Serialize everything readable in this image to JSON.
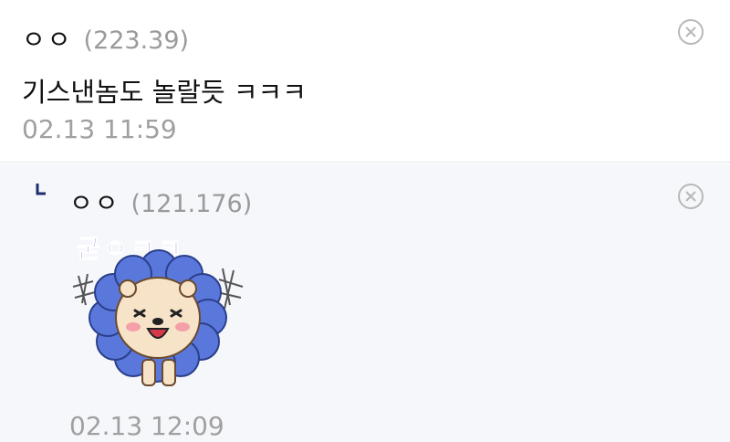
{
  "main_comment": {
    "author": "ㅇㅇ",
    "ip": "(223.39)",
    "text": "기스낸놈도 놀랄듯 ㅋㅋㅋ",
    "timestamp": "02.13 11:59",
    "delete_icon": "circle-x-icon"
  },
  "reply_comment": {
    "reply_icon": "reply-arrow-icon",
    "author": "ㅇㅇ",
    "ip": "(121.176)",
    "sticker_text": "굳ㅇㅋㅋ",
    "timestamp": "02.13 12:09",
    "delete_icon": "circle-x-icon"
  },
  "colors": {
    "sticker_text": "#7b5bd6",
    "mane": "#5a78dc",
    "face": "#f7e3c8"
  }
}
